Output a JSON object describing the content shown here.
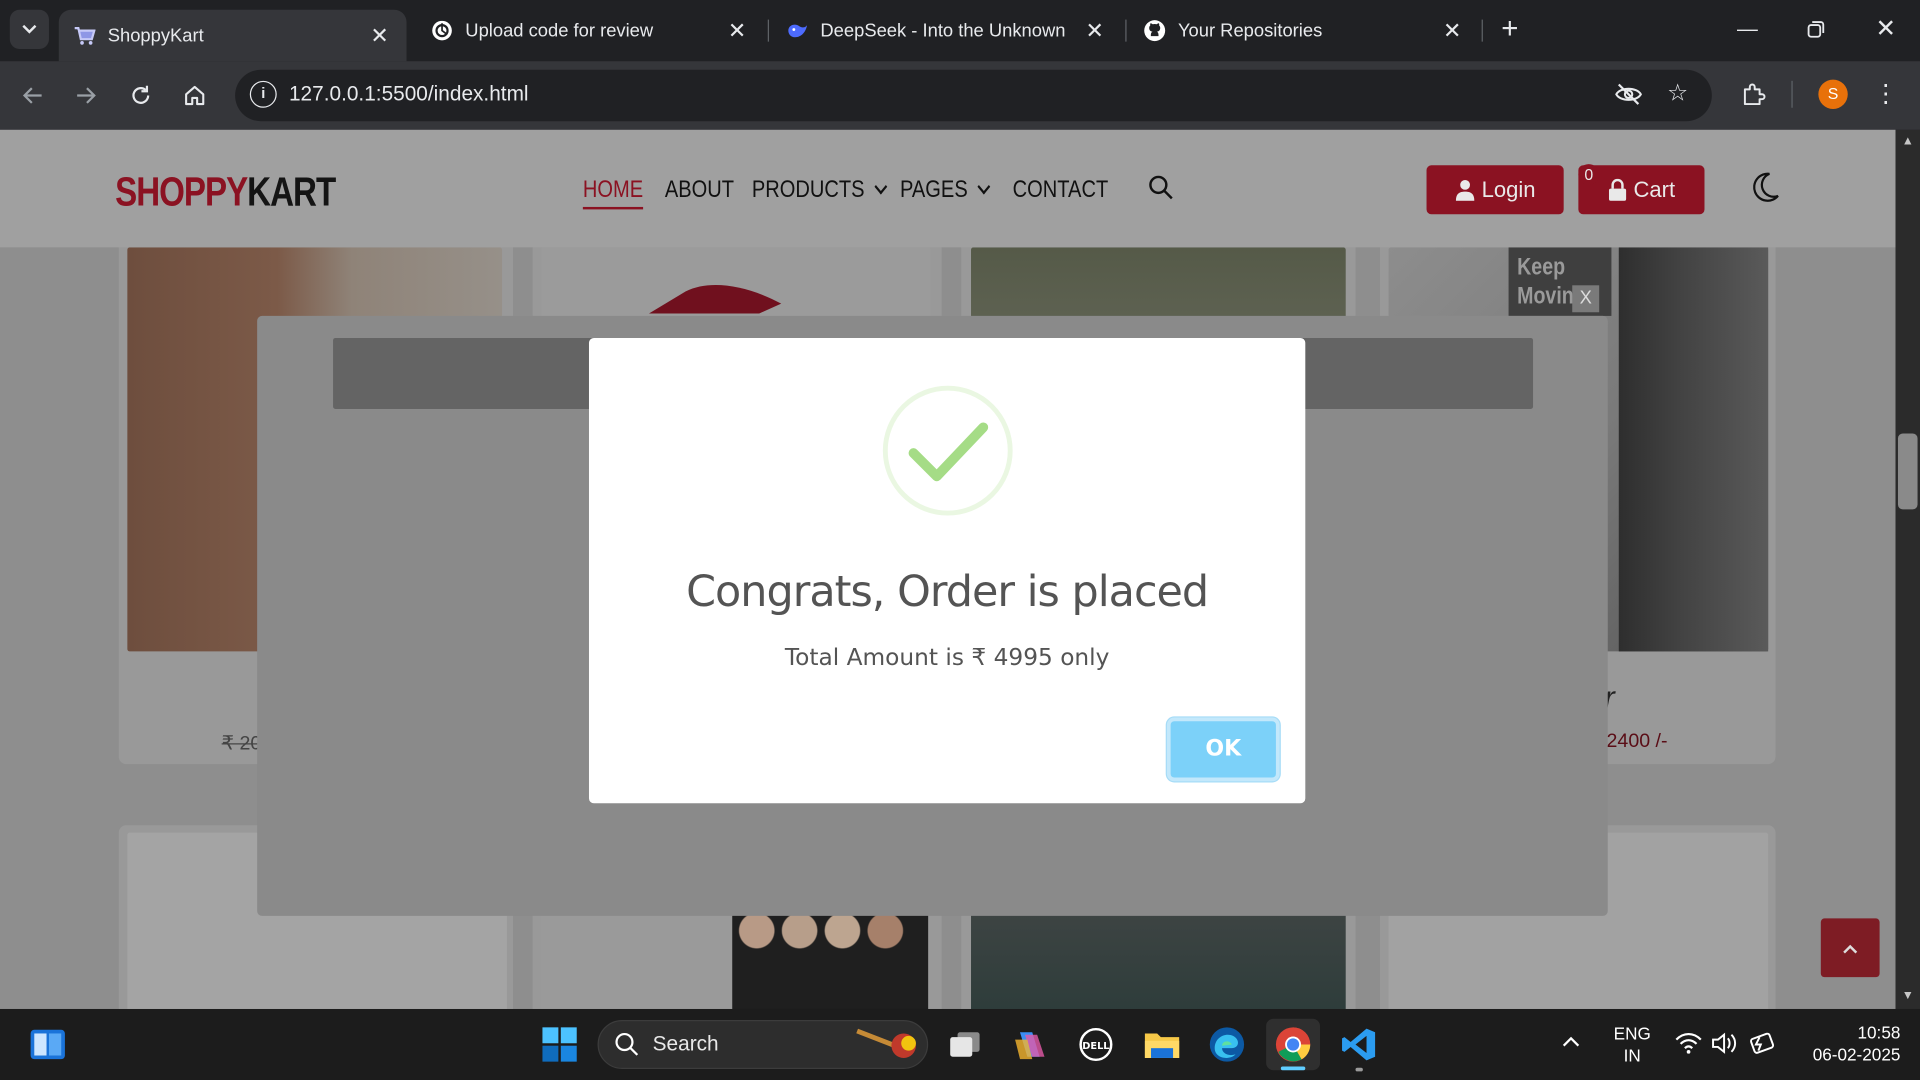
{
  "browser": {
    "tabs": [
      {
        "label": "ShoppyKart",
        "icon": "cart-favicon",
        "active": true
      },
      {
        "label": "Upload code for review",
        "icon": "chatgpt-favicon",
        "active": false
      },
      {
        "label": "DeepSeek - Into the Unknown",
        "icon": "deepseek-favicon",
        "active": false
      },
      {
        "label": "Your Repositories",
        "icon": "github-favicon",
        "active": false
      }
    ],
    "url": "127.0.0.1:5500/index.html",
    "profile_initial": "S"
  },
  "site": {
    "logo_part1": "SHOPPY",
    "logo_part2": "KART",
    "nav": [
      {
        "label": "HOME",
        "active": true
      },
      {
        "label": "ABOUT"
      },
      {
        "label": "PRODUCTS",
        "dropdown": true
      },
      {
        "label": "PAGES",
        "dropdown": true
      },
      {
        "label": "CONTACT"
      }
    ],
    "login_label": "Login",
    "cart_label": "Cart",
    "cart_count": "0",
    "backdrop_close": "X",
    "banner_text_1": "Keep",
    "banner_text_2": "Movin",
    "card_price_left": "₹ 20",
    "card_price_right": "2400 /-",
    "card_title_fragment": "r"
  },
  "modal": {
    "title": "Congrats, Order is placed",
    "text": "Total Amount is ₹ 4995 only",
    "ok_label": "OK",
    "accent": "#a5dc86",
    "ok_color": "#7cd1f9"
  },
  "taskbar": {
    "search_placeholder": "Search",
    "lang_line1": "ENG",
    "lang_line2": "IN",
    "time": "10:58",
    "date": "06-02-2025"
  },
  "colors": {
    "brand": "#8b1222",
    "browser_bg": "#202124",
    "toolbar_bg": "#35363a"
  }
}
